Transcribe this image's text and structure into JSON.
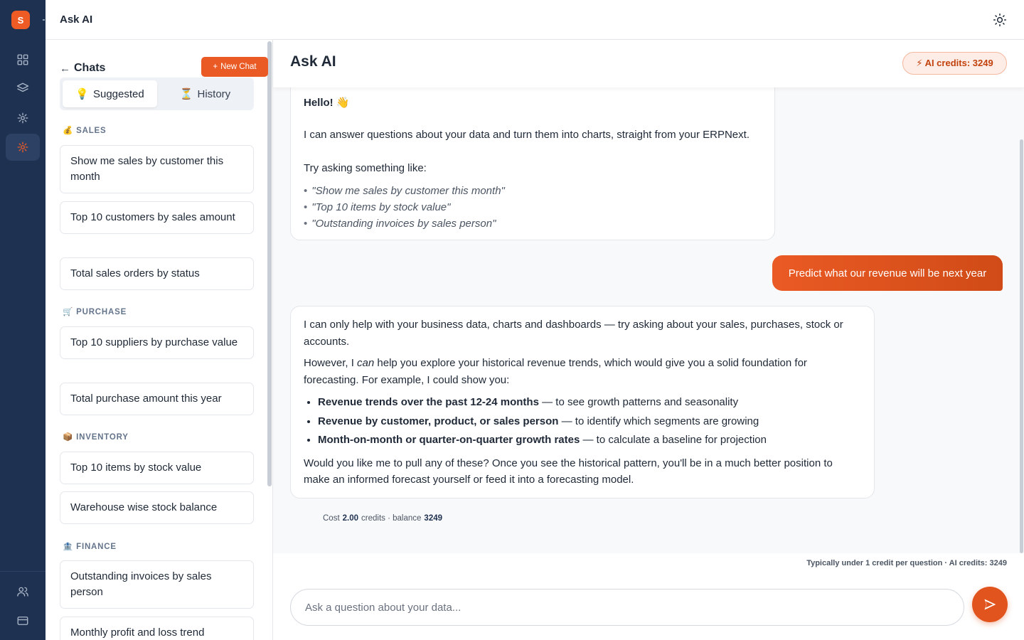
{
  "app": {
    "logo_letter": "S",
    "title": "Ask AI"
  },
  "rail": {
    "icons": [
      "grid-icon",
      "layers-icon",
      "sparkle-icon",
      "sparkle-icon-active",
      "users-icon",
      "card-icon"
    ]
  },
  "chats": {
    "title": "Chats",
    "back_symbol": "←",
    "new_chat_label": "New Chat",
    "new_chat_symbol": "+",
    "tabs": [
      {
        "emoji": "💡",
        "label": "Suggested"
      },
      {
        "emoji": "⏳",
        "label": "History"
      }
    ],
    "categories": [
      {
        "emoji": "💰",
        "label": "SALES"
      },
      {
        "emoji": "🛒",
        "label": "PURCHASE"
      },
      {
        "emoji": "📦",
        "label": "INVENTORY"
      },
      {
        "emoji": "🏦",
        "label": "FINANCE"
      }
    ],
    "suggestions": [
      "Show me sales by customer this month",
      "Top 10 customers by sales amount",
      "Total sales orders by status",
      "Top 10 suppliers by purchase value",
      "Total purchase amount this year",
      "Top 10 items by stock value",
      "Warehouse wise stock balance",
      "Outstanding invoices by sales person",
      "Monthly profit and loss trend"
    ]
  },
  "main": {
    "title": "Ask AI",
    "credits_badge": "⚡ AI credits: 3249",
    "welcome": {
      "hello": "Hello! 👋",
      "intro": "I can answer questions about your data and turn them into charts, straight from your ERPNext.",
      "try": "Try asking something like:",
      "examples": [
        "\"Show me sales by customer this month\"",
        "\"Top 10 items by stock value\"",
        "\"Outstanding invoices by sales person\""
      ]
    },
    "user_message": "Predict what our revenue will be next year",
    "reply": {
      "p1": "I can only help with your business data, charts and dashboards — try asking about your sales, purchases, stock or accounts.",
      "p2_before": "However, I ",
      "p2_em": "can",
      "p2_after": " help you explore your historical revenue trends, which would give you a solid foundation for forecasting. For example, I could show you:",
      "bullets": [
        {
          "bold": "Revenue trends over the past 12-24 months",
          "rest": " — to see growth patterns and seasonality"
        },
        {
          "bold": "Revenue by customer, product, or sales person",
          "rest": " — to identify which segments are growing"
        },
        {
          "bold": "Month-on-month or quarter-on-quarter growth rates",
          "rest": " — to calculate a baseline for projection"
        }
      ],
      "p3": "Would you like me to pull any of these? Once you see the historical pattern, you'll be in a much better position to make an informed forecast yourself or feed it into a forecasting model."
    },
    "cost": {
      "label": "Cost",
      "value": "2.00",
      "middle": "credits · balance",
      "balance": "3249"
    },
    "hint": "Typically under 1 credit per question · AI credits: 3249",
    "input_placeholder": "Ask a question about your data..."
  },
  "colors": {
    "accent": "#ea5a24",
    "rail": "#1f3150"
  }
}
